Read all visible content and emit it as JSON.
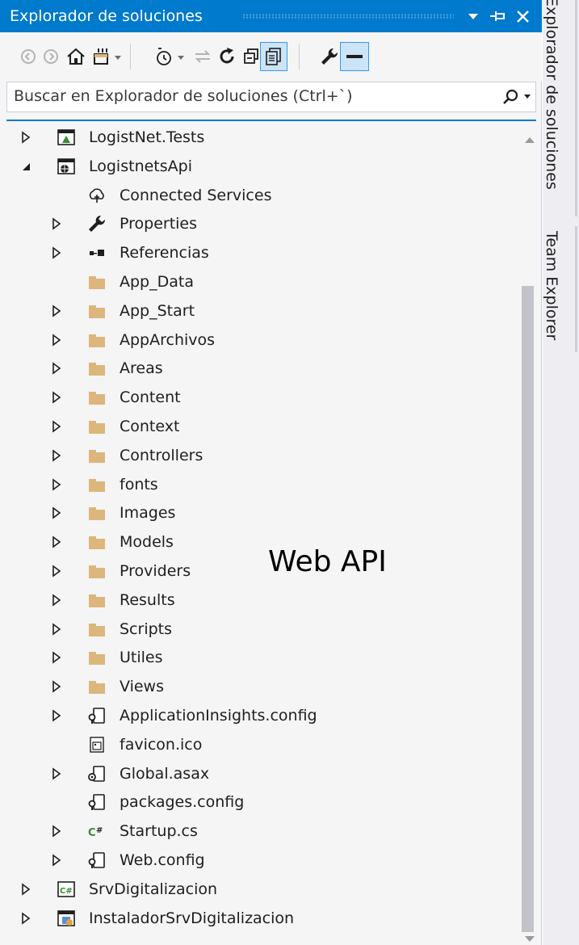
{
  "window": {
    "title": "Explorador de soluciones",
    "pin_label": "Auto Hide",
    "close_label": "Close"
  },
  "toolbar": {
    "buttons": [
      "back-icon",
      "forward-icon",
      "home-icon",
      "switch-views-icon",
      "pending-changes-filter-icon",
      "sync-active-doc-icon",
      "refresh-icon",
      "collapse-all-icon",
      "show-all-files-icon",
      "properties-icon",
      "preview-selected-icon"
    ]
  },
  "search": {
    "placeholder": "Buscar en Explorador de soluciones (Ctrl+`)"
  },
  "tree": [
    {
      "label": "LogistNet.Tests",
      "icon": "test-project-icon",
      "expanded": false
    },
    {
      "label": "LogistnetsApi",
      "icon": "web-project-icon",
      "expanded": true
    },
    {
      "label": "Connected Services",
      "icon": "connected-services-icon"
    },
    {
      "label": "Properties",
      "icon": "wrench-icon",
      "expanded": false
    },
    {
      "label": "Referencias",
      "icon": "references-icon",
      "expanded": false
    },
    {
      "label": "App_Data",
      "icon": "folder-icon"
    },
    {
      "label": "App_Start",
      "icon": "folder-icon",
      "expanded": false
    },
    {
      "label": "AppArchivos",
      "icon": "folder-icon",
      "expanded": false
    },
    {
      "label": "Areas",
      "icon": "folder-icon",
      "expanded": false
    },
    {
      "label": "Content",
      "icon": "folder-icon",
      "expanded": false
    },
    {
      "label": "Context",
      "icon": "folder-icon",
      "expanded": false
    },
    {
      "label": "Controllers",
      "icon": "folder-icon",
      "expanded": false
    },
    {
      "label": "fonts",
      "icon": "folder-icon",
      "expanded": false
    },
    {
      "label": "Images",
      "icon": "folder-icon",
      "expanded": false
    },
    {
      "label": "Models",
      "icon": "folder-icon",
      "expanded": false
    },
    {
      "label": "Providers",
      "icon": "folder-icon",
      "expanded": false
    },
    {
      "label": "Results",
      "icon": "folder-icon",
      "expanded": false
    },
    {
      "label": "Scripts",
      "icon": "folder-icon",
      "expanded": false
    },
    {
      "label": "Utiles",
      "icon": "folder-icon",
      "expanded": false
    },
    {
      "label": "Views",
      "icon": "folder-icon",
      "expanded": false
    },
    {
      "label": "ApplicationInsights.config",
      "icon": "config-file-icon",
      "expanded": false
    },
    {
      "label": "favicon.ico",
      "icon": "image-file-icon"
    },
    {
      "label": "Global.asax",
      "icon": "asax-file-icon",
      "expanded": false
    },
    {
      "label": "packages.config",
      "icon": "config-file-icon"
    },
    {
      "label": "Startup.cs",
      "icon": "csharp-file-icon",
      "expanded": false
    },
    {
      "label": "Web.config",
      "icon": "config-file-icon",
      "expanded": false
    },
    {
      "label": "SrvDigitalizacion",
      "icon": "csharp-project-icon",
      "expanded": false
    },
    {
      "label": "InstaladorSrvDigitalizacion",
      "icon": "setup-project-icon",
      "expanded": false
    }
  ],
  "side_tabs": [
    "Explorador de soluciones",
    "Team Explorer"
  ],
  "overlay": {
    "text": "Web API"
  },
  "colors": {
    "accent": "#007acc",
    "folder": "#dcb67a",
    "panel_bg": "#f5f5f5",
    "text": "#1e1e1e"
  }
}
